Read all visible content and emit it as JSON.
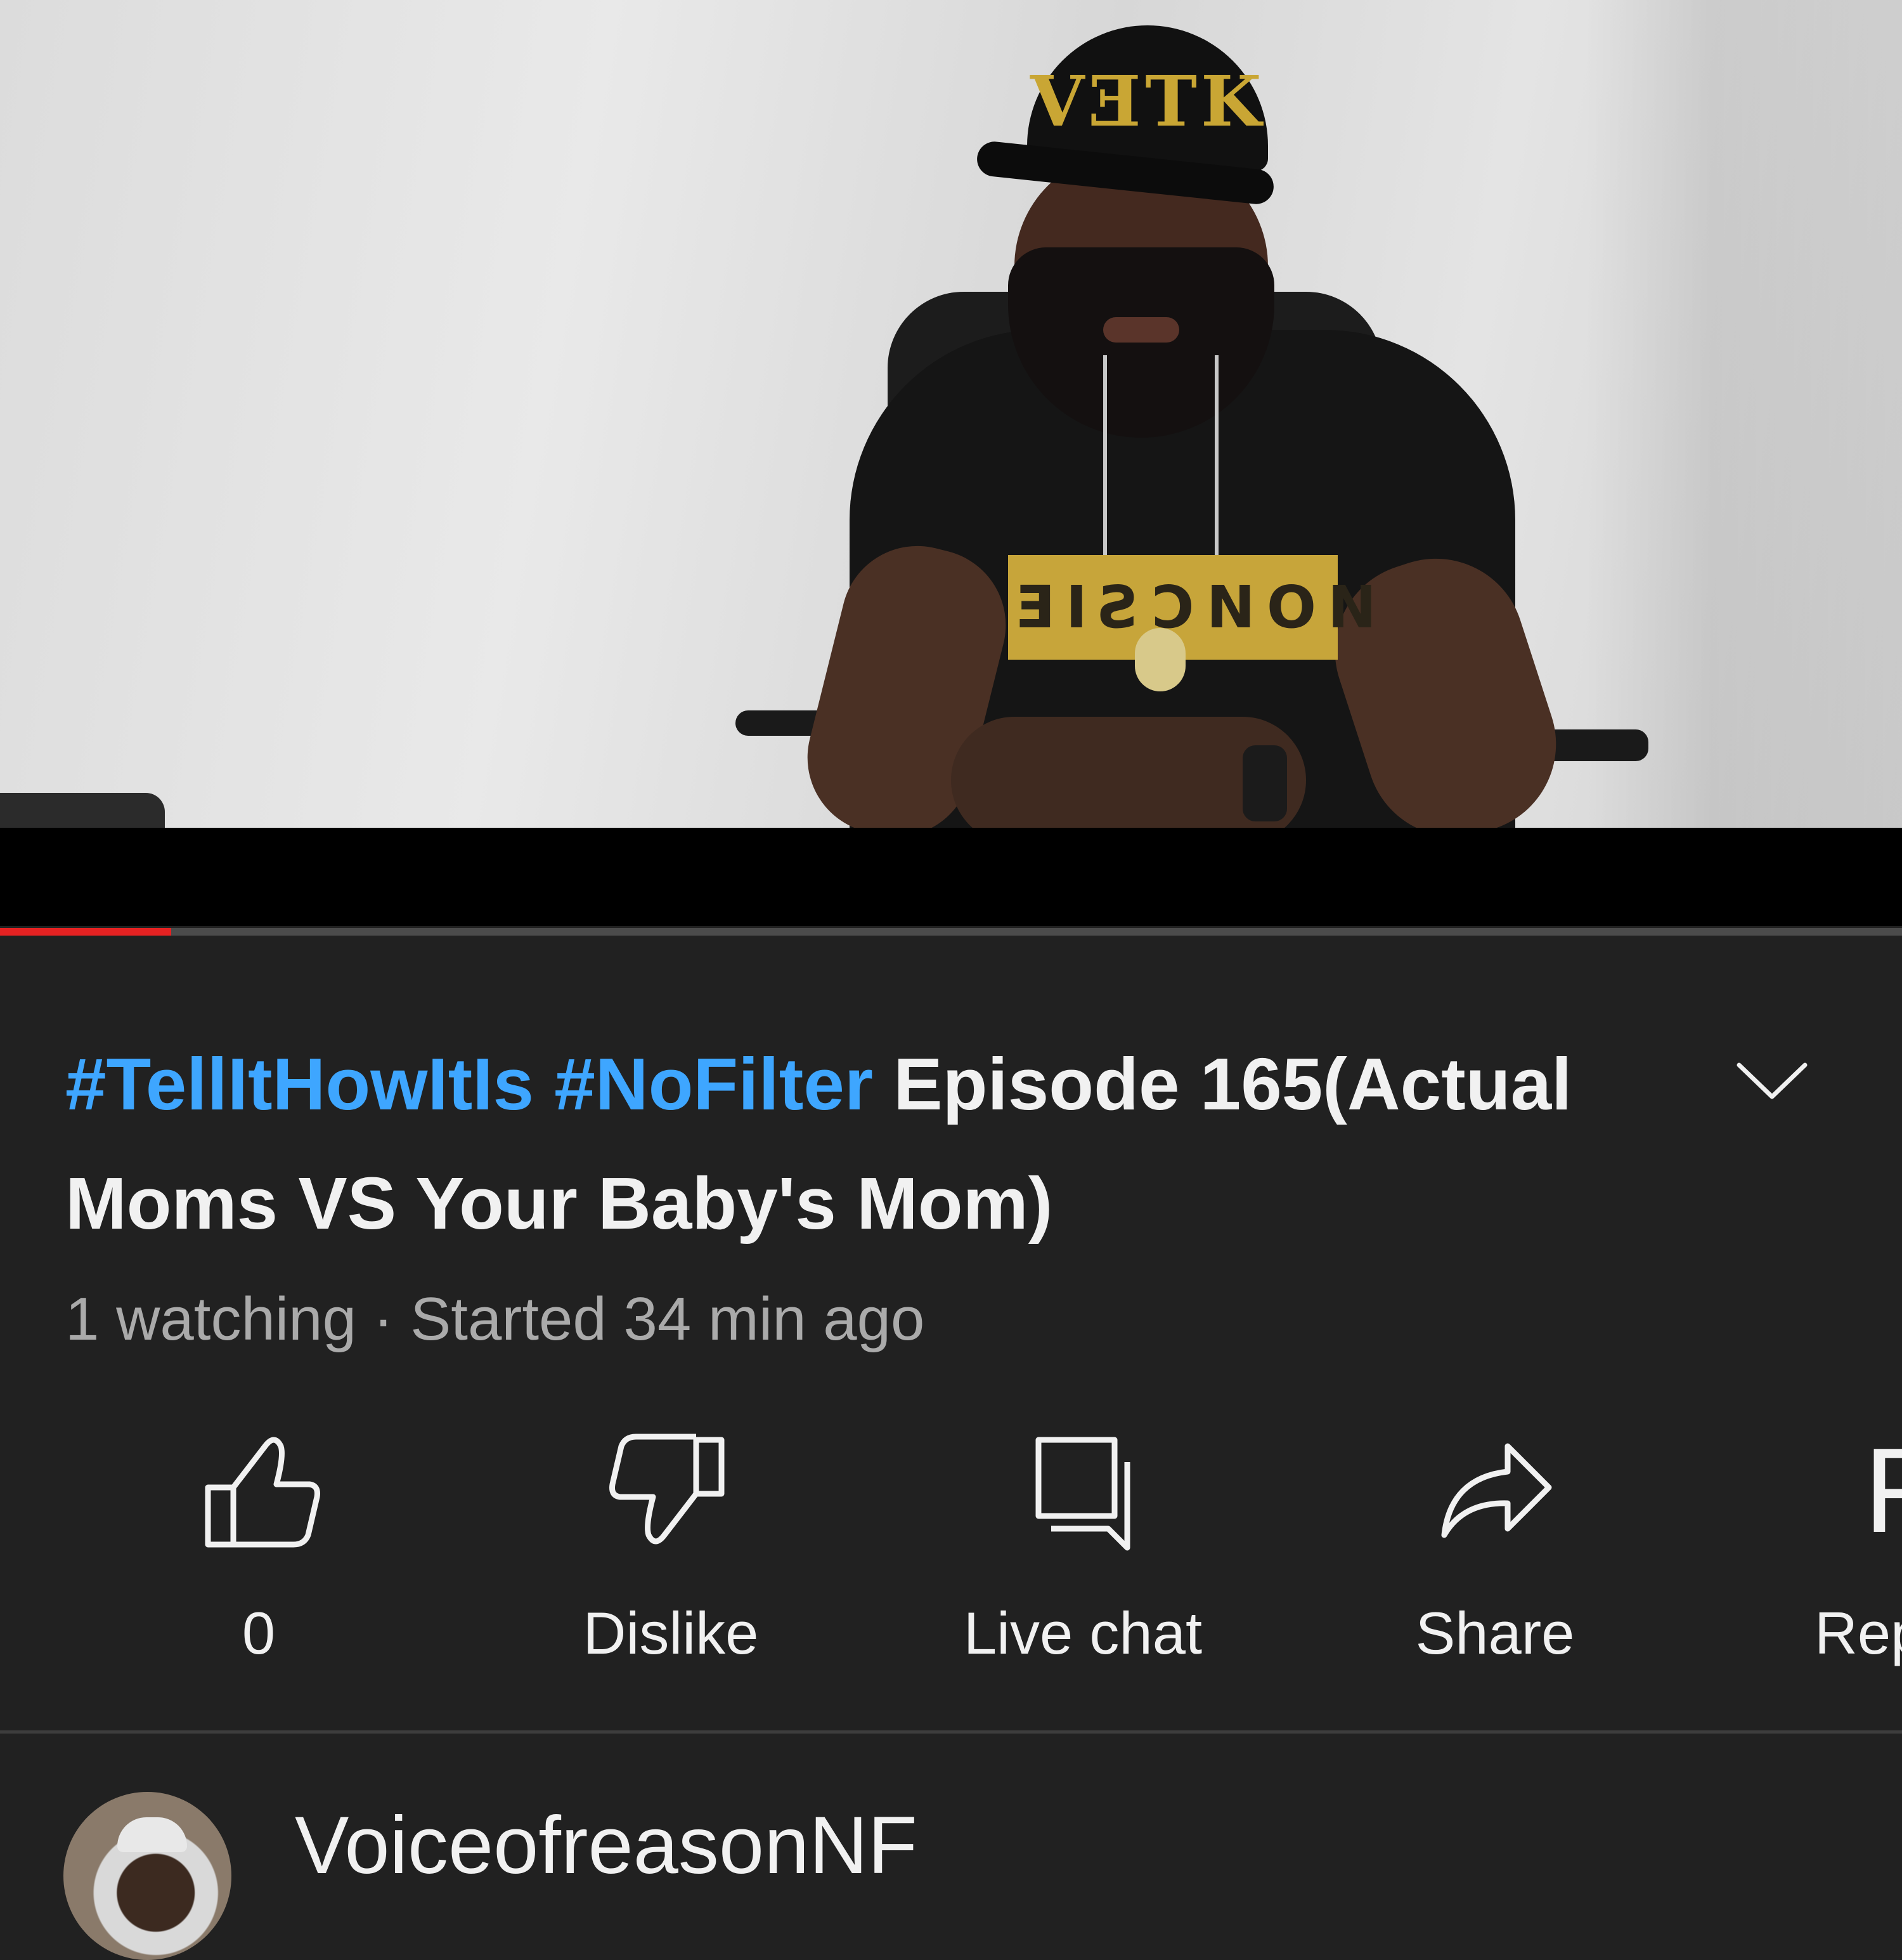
{
  "video": {
    "progress_fraction": 0.09,
    "cap_logo": "VƎTK",
    "shirt_text": "ƎIƧƆNON",
    "colors": {
      "progress": "#e52222",
      "track": "#4b4b4b",
      "hashtag": "#3ea6ff"
    }
  },
  "title": {
    "hashtag_1": "#TellItHowItIs",
    "hashtag_2": "#NoFilter",
    "text": "Episode 165(Actual Moms VS Your Baby's Mom)"
  },
  "meta": {
    "watching": "1 watching",
    "separator": " · ",
    "started": "Started 34 min ago"
  },
  "actions": {
    "like_count": "0",
    "dislike_label": "Dislike",
    "live_chat_label": "Live chat",
    "share_label": "Share",
    "report_label": "Rep",
    "report_icon_glyph": "F",
    "icons": [
      "thumbs-up-icon",
      "thumbs-down-icon",
      "live-chat-icon",
      "share-icon",
      "flag-icon"
    ]
  },
  "channel": {
    "name": "VoiceofreasonNF"
  }
}
